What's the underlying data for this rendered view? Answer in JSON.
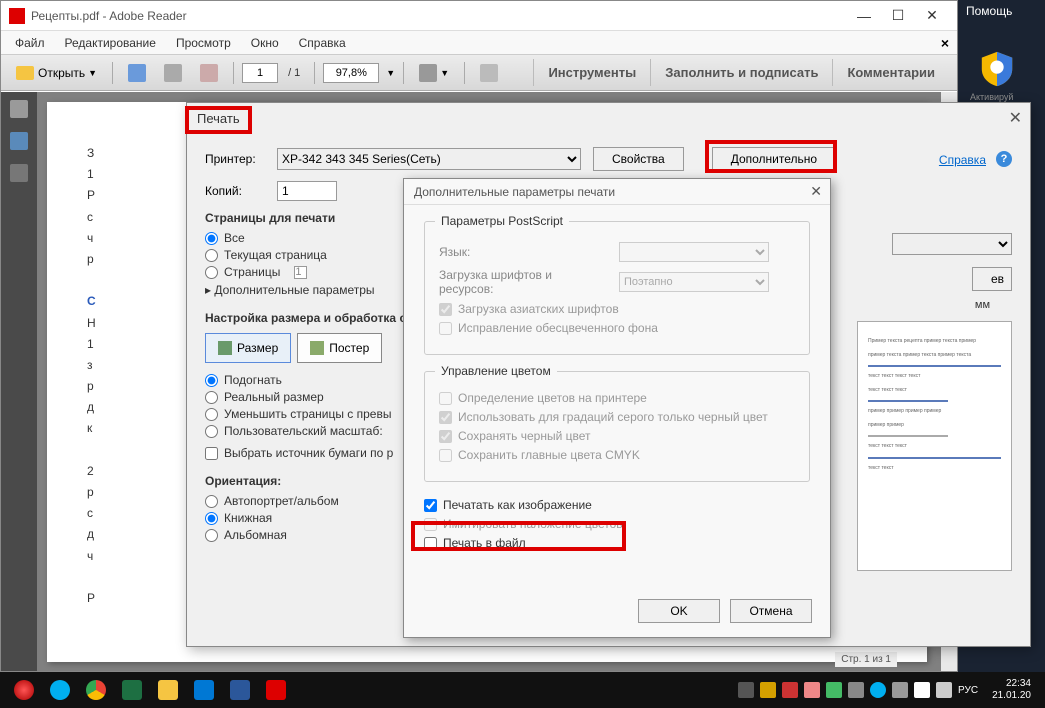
{
  "titlebar": {
    "title": "Рецепты.pdf - Adobe Reader"
  },
  "menubar": {
    "items": [
      "Файл",
      "Редактирование",
      "Просмотр",
      "Окно",
      "Справка"
    ]
  },
  "toolbar": {
    "open": "Открыть",
    "page_current": "1",
    "page_total": "/ 1",
    "zoom": "97,8%",
    "right": [
      "Инструменты",
      "Заполнить и подписать",
      "Комментарии"
    ]
  },
  "print": {
    "title": "Печать",
    "printer_label": "Принтер:",
    "printer_value": "XP-342 343 345 Series(Сеть)",
    "properties": "Свойства",
    "advanced": "Дополнительно",
    "copies_label": "Копий:",
    "copies_value": "1",
    "help": "Справка",
    "pages_group": "Страницы для печати",
    "all": "Все",
    "current": "Текущая страница",
    "range": "Страницы",
    "range_value": "1",
    "more": "Дополнительные параметры",
    "size_group": "Настройка размера и обработка страниц",
    "size_btn": "Размер",
    "poster_btn": "Постер",
    "fit": "Подогнать",
    "actual": "Реальный размер",
    "shrink": "Уменьшить страницы с превы",
    "custom": "Пользовательский масштаб:",
    "paper_source": "Выбрать источник бумаги по р",
    "orientation": "Ориентация:",
    "auto_portrait": "Автопортрет/альбом",
    "portrait": "Книжная",
    "landscape": "Альбомная",
    "preview_unit": "мм",
    "setup": "ев"
  },
  "adv": {
    "title": "Дополнительные параметры печати",
    "ps_group": "Параметры PostScript",
    "lang": "Язык:",
    "font_load": "Загрузка шрифтов и ресурсов:",
    "font_load_value": "Поэтапно",
    "asian": "Загрузка азиатских шрифтов",
    "bleached": "Исправление обесцвеченного фона",
    "color_group": "Управление цветом",
    "printer_color": "Определение цветов на принтере",
    "gray_black": "Использовать для градаций серого только черный цвет",
    "preserve_black": "Сохранять черный цвет",
    "preserve_cmyk": "Сохранить главные цвета CMYK",
    "print_as_image": "Печатать как изображение",
    "simulate_overprint": "Имитировать наложение цветов",
    "print_to_file": "Печать в файл",
    "ok": "OK",
    "cancel": "Отмена"
  },
  "os": {
    "help": "Помощь",
    "activate": "Активируй",
    "lang": "РУС",
    "time": "22:34",
    "date": "21.01.20"
  },
  "page_status": "Стр. 1 из 1"
}
